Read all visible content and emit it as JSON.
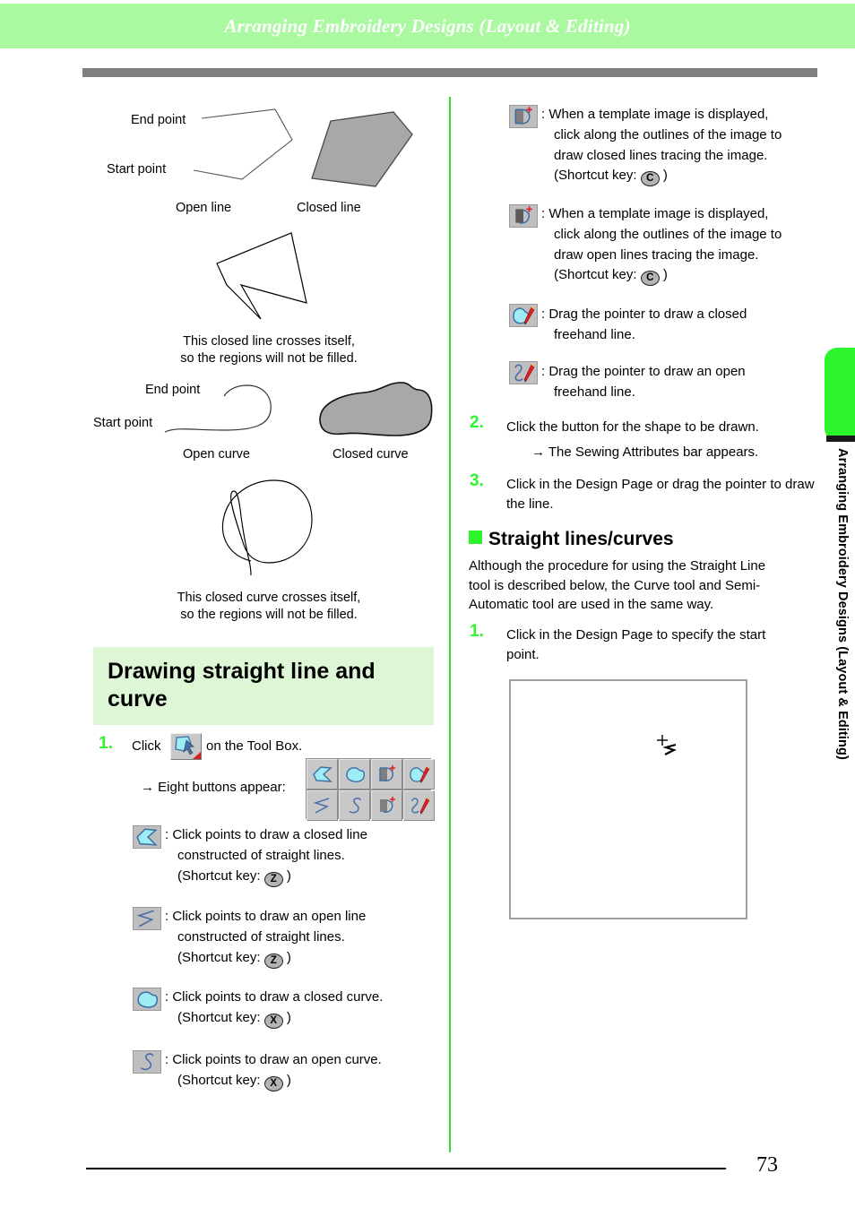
{
  "header": {
    "title": "Arranging Embroidery Designs (Layout & Editing)"
  },
  "side_tab": {
    "label": "Arranging Embroidery Designs (Layout & Editing)"
  },
  "footer": {
    "page_number": "73"
  },
  "figures": {
    "line_figure": {
      "end_point_label": "End point",
      "start_point_label": "Start point",
      "open_label": "Open line",
      "closed_label": "Closed line",
      "caption_line_1": "This closed line crosses itself,",
      "caption_line_2": "so the regions will not be filled."
    },
    "curve_figure": {
      "end_point_label": "End point",
      "start_point_label": "Start point",
      "open_label": "Open curve",
      "closed_label": "Closed curve",
      "caption_line_1": "This closed curve crosses itself,",
      "caption_line_2": "so the regions will not be filled."
    }
  },
  "section": {
    "heading": "Drawing straight line and curve",
    "step1": {
      "number": "1",
      "text_before": "Click",
      "text_after": "on the Tool Box.",
      "result": "→ Eight buttons appear:"
    },
    "step2": {
      "number": "2",
      "text": "Click the button for the shape to be drawn.",
      "result": "→ The Sewing Attributes bar appears."
    },
    "step3": {
      "number": "3",
      "text": "Click in the Design Page or drag the pointer to draw the line."
    }
  },
  "tool_definitions": [
    {
      "icon": "closed-straight-line-icon",
      "colon": ":",
      "line1": "Click points to draw a closed line",
      "line2": "constructed of straight lines.",
      "shortcut_prefix": "(Shortcut key:",
      "shortcut_key": "Z",
      "shortcut_suffix": ")"
    },
    {
      "icon": "open-straight-line-icon",
      "colon": ":",
      "line1": "Click points to draw an open line",
      "line2": "constructed of straight lines.",
      "shortcut_prefix": "(Shortcut key:",
      "shortcut_key": "Z",
      "shortcut_suffix": ")"
    },
    {
      "icon": "closed-curve-icon",
      "colon": ":",
      "line1": "Click points to draw a closed curve.",
      "line2": "",
      "shortcut_prefix": "(Shortcut key:",
      "shortcut_key": "X",
      "shortcut_suffix": ")"
    },
    {
      "icon": "open-curve-icon",
      "colon": ":",
      "line1": "Click points to draw an open curve.",
      "line2": "",
      "shortcut_prefix": "(Shortcut key:",
      "shortcut_key": "X",
      "shortcut_suffix": ")"
    },
    {
      "icon": "semi-auto-closed-icon",
      "colon": ":",
      "line1": "When a template image is displayed,",
      "line2": "click along the outlines of the image to",
      "line3": "draw closed lines tracing the image.",
      "shortcut_prefix": "(Shortcut key:",
      "shortcut_key": "C",
      "shortcut_suffix": ")"
    },
    {
      "icon": "semi-auto-open-icon",
      "colon": ":",
      "line1": "When a template image is displayed,",
      "line2": "click along the outlines of the image to",
      "line3": "draw open lines tracing the image.",
      "shortcut_prefix": "(Shortcut key:",
      "shortcut_key": "C",
      "shortcut_suffix": ")"
    },
    {
      "icon": "freehand-closed-icon",
      "colon": ":",
      "line1": "Drag the pointer to draw a closed",
      "line2": "freehand line.",
      "shortcut_prefix": "",
      "shortcut_key": "",
      "shortcut_suffix": ""
    },
    {
      "icon": "freehand-open-icon",
      "colon": ":",
      "line1": "Drag the pointer to draw an open",
      "line2": "freehand line.",
      "shortcut_prefix": "",
      "shortcut_key": "",
      "shortcut_suffix": ""
    }
  ],
  "straight_lines_section": {
    "heading": "Straight lines/curves",
    "para_line1": "Although the procedure for using the Straight Line",
    "para_line2": "tool is described below, the Curve tool and Semi-",
    "para_line3": "Automatic tool are used in the same way.",
    "step1": {
      "number": "1",
      "line1": "Click in the Design Page to specify the start",
      "line2": "point."
    }
  },
  "colors": {
    "header_band": "#aaf9a0",
    "accent_green": "#2cf52c",
    "divider_green": "#33e033",
    "heading_band": "#ddf6d5",
    "shape_fill": "#a8a8a8",
    "icon_cyan": "#9fecf5",
    "icon_blue_line": "#4a6fa8",
    "icon_red": "#e02020",
    "button_face": "#c8c8c8"
  }
}
